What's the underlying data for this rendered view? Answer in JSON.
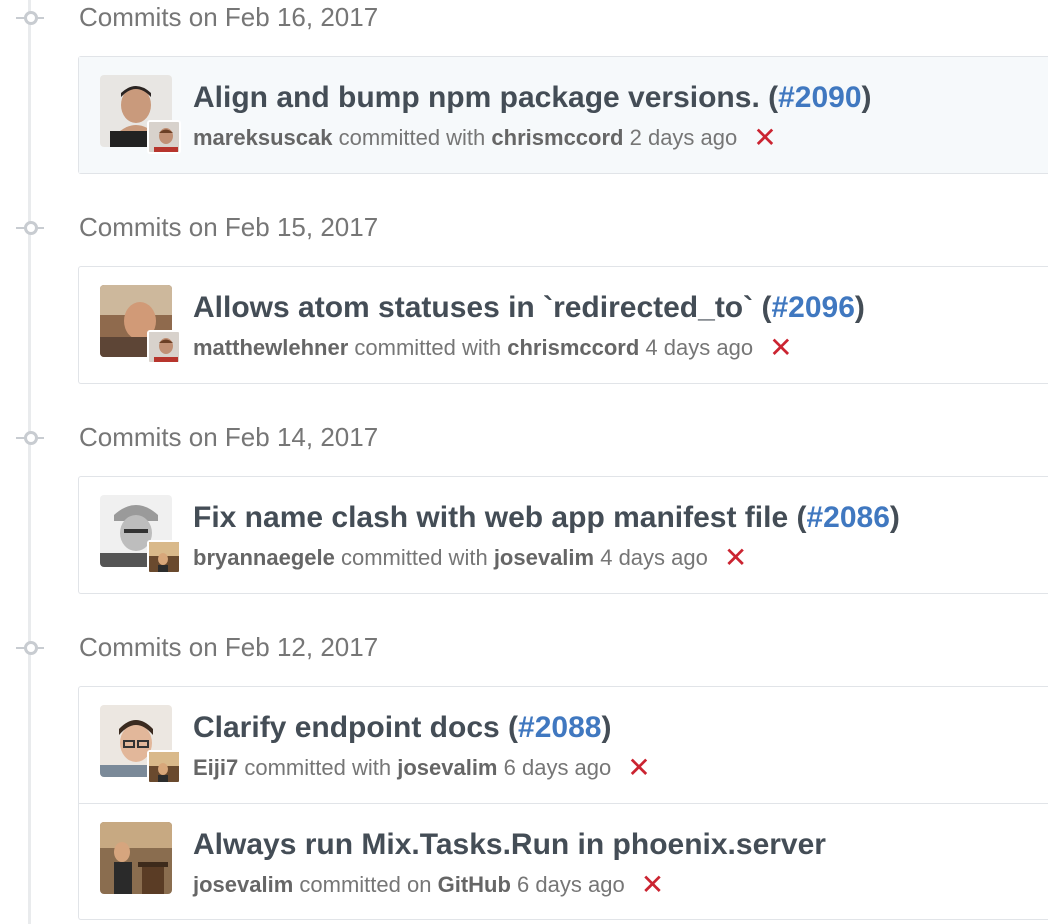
{
  "days": [
    {
      "title": "Commits on Feb 16, 2017",
      "commits": [
        {
          "message": "Align and bump npm package versions. (",
          "pr": "#2090",
          "close": ")",
          "author": "mareksuscak",
          "verb": "committed with",
          "committer": "chrismccord",
          "time": "2 days ago",
          "status_icon": "✕",
          "highlight": true
        }
      ]
    },
    {
      "title": "Commits on Feb 15, 2017",
      "commits": [
        {
          "message": "Allows atom statuses in `redirected_to` (",
          "pr": "#2096",
          "close": ")",
          "author": "matthewlehner",
          "verb": "committed with",
          "committer": "chrismccord",
          "time": "4 days ago",
          "status_icon": "✕"
        }
      ]
    },
    {
      "title": "Commits on Feb 14, 2017",
      "commits": [
        {
          "message": "Fix name clash with web app manifest file (",
          "pr": "#2086",
          "close": ")",
          "author": "bryannaegele",
          "verb": "committed with",
          "committer": "josevalim",
          "time": "4 days ago",
          "status_icon": "✕"
        }
      ]
    },
    {
      "title": "Commits on Feb 12, 2017",
      "commits": [
        {
          "message": "Clarify endpoint docs (",
          "pr": "#2088",
          "close": ")",
          "author": "Eiji7",
          "verb": "committed with",
          "committer": "josevalim",
          "time": "6 days ago",
          "status_icon": "✕"
        },
        {
          "message": "Always run Mix.Tasks.Run in phoenix.server",
          "pr": "",
          "close": "",
          "author": "josevalim",
          "verb": "committed on",
          "committer": "GitHub",
          "time": "6 days ago",
          "status_icon": "✕"
        }
      ]
    }
  ],
  "colors": {
    "link": "#4078c0",
    "failure": "#cb2431",
    "muted": "#767676",
    "title": "#444d56"
  }
}
